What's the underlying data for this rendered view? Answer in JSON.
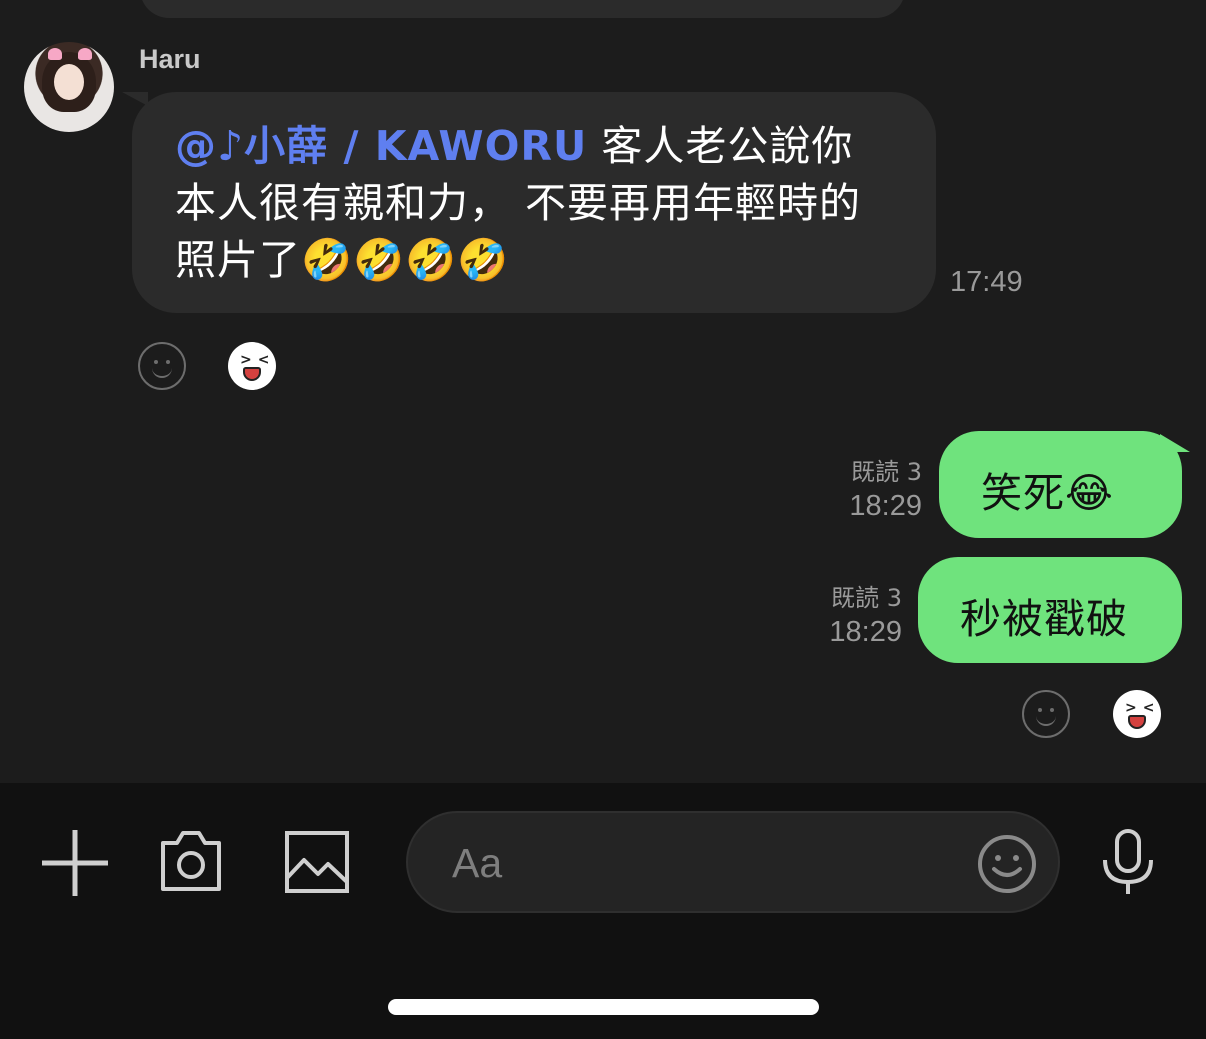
{
  "incoming_message": {
    "sender": "Haru",
    "mention": "@♪小薛 / KAWORU",
    "text_line1_rest": " 客人老公說你",
    "text_line2": "本人很有親和力， 不要再用年輕時的",
    "text_line3": "照片了🤣🤣🤣🤣",
    "time": "17:49",
    "reaction_sticker": "laughing-face-sticker"
  },
  "outgoing_messages": [
    {
      "text": "笑死😂",
      "read": "既読 3",
      "time": "18:29"
    },
    {
      "text": "秒被戳破",
      "read": "既読 3",
      "time": "18:29",
      "reaction_sticker": "laughing-face-sticker"
    }
  ],
  "composer": {
    "placeholder": "Aa",
    "icons": [
      "plus-icon",
      "camera-icon",
      "image-icon",
      "emoji-icon",
      "microphone-icon"
    ]
  },
  "colors": {
    "background": "#1c1c1c",
    "incoming_bubble": "#2b2b2b",
    "outgoing_bubble": "#6fe37d",
    "mention": "#5f7ff0"
  }
}
